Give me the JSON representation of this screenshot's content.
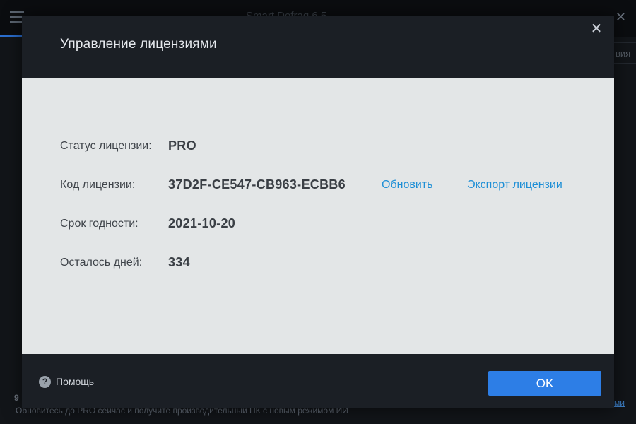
{
  "background": {
    "title": "Smart Defrag 6.5",
    "tab_partial": "вия",
    "upgrade_num": "9",
    "upgrade_text": "Обновитесь до PRO сейчас и получите производительный ПК с новым режимом ИИ",
    "link_partial": "ми"
  },
  "dialog": {
    "title": "Управление лицензиями",
    "close_glyph": "✕",
    "rows": [
      {
        "label": "Статус лицензии:",
        "value": "PRO"
      },
      {
        "label": "Код лицензии:",
        "value": "37D2F-CE547-CB963-ECBB6"
      },
      {
        "label": "Срок годности:",
        "value": "2021-10-20"
      },
      {
        "label": "Осталось дней:",
        "value": "334"
      }
    ],
    "links": {
      "update": "Обновить",
      "export": "Экспорт лицензии"
    },
    "footer": {
      "help_label": "Помощь",
      "help_glyph": "?",
      "ok_label": "OK"
    }
  },
  "colors": {
    "accent": "#2d7ee6",
    "link": "#1e8fd6",
    "dialog_bg": "#1b1f25",
    "body_bg": "#e3e6e7"
  },
  "icons": [
    "menu-icon",
    "close-icon",
    "help-icon"
  ]
}
